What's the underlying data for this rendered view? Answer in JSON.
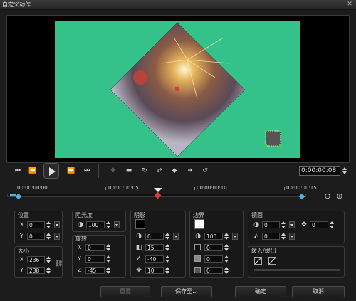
{
  "window": {
    "title": "自定义动作",
    "close_glyph": "✕"
  },
  "transport": {
    "timecode": "0:00:00:08"
  },
  "timeline": {
    "marks": [
      "00:00:00:00",
      "00:00:00:05",
      "00:00:00:10",
      "00:00:00:15"
    ]
  },
  "position": {
    "title": "位置",
    "x_label": "X",
    "x": "0",
    "y_label": "Y",
    "y": "0"
  },
  "size": {
    "title": "大小",
    "x_label": "X",
    "x": "236",
    "y_label": "Y",
    "y": "238"
  },
  "opacity": {
    "title": "阻光度",
    "value": "100"
  },
  "rotation": {
    "title": "旋转",
    "x_label": "X",
    "x": "0",
    "y_label": "Y",
    "y": "0",
    "z_label": "Z",
    "z": "-45"
  },
  "shadow": {
    "title": "阴影",
    "color": "#000000",
    "opacity": "0",
    "distance": "15",
    "angle": "-40",
    "blur": "10"
  },
  "border": {
    "title": "边界",
    "color": "#ffffff",
    "opacity": "100",
    "v1": "0",
    "v2": "0",
    "v3": "0"
  },
  "mirror": {
    "title": "镜面",
    "v1": "0",
    "v2": "0",
    "v3": "0"
  },
  "fade": {
    "title": "缓入/缓出"
  },
  "buttons": {
    "reset": "重置",
    "save_to": "保存至...",
    "ok": "确定",
    "cancel": "取消"
  },
  "colors": {
    "canvas": "#34c28a",
    "accent_blue": "#49b6e6",
    "keyframe_red": "#e23a3a",
    "dark": "#181818"
  }
}
